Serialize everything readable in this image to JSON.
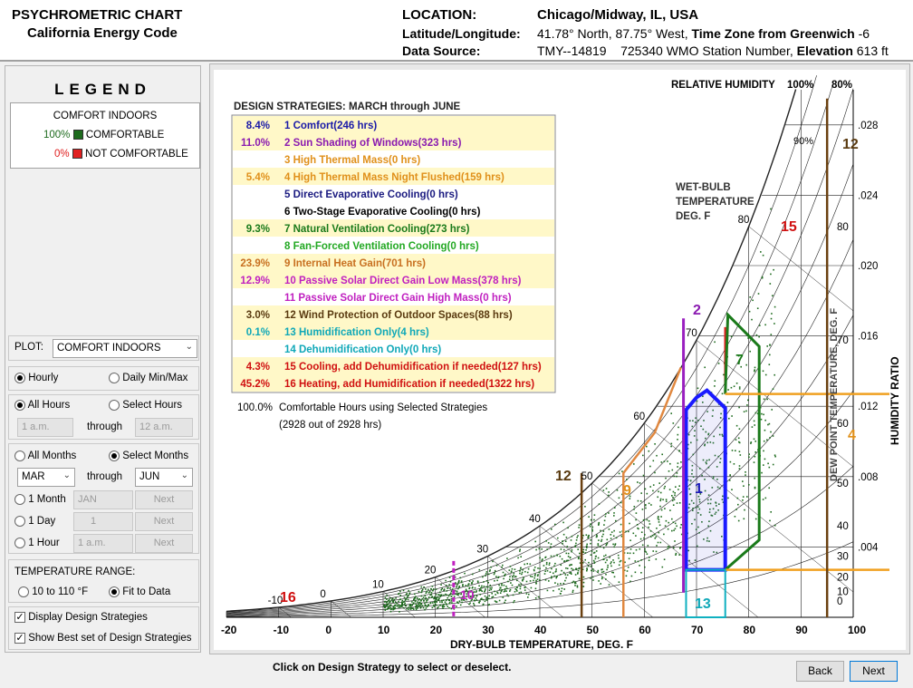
{
  "header": {
    "title1": "PSYCHROMETRIC CHART",
    "title2": "California Energy Code",
    "location_label": "LOCATION:",
    "location_value": "Chicago/Midway, IL, USA",
    "latlon_label": "Latitude/Longitude:",
    "latlon_value": "41.78° North, 87.75° West,",
    "tz_label": "Time Zone from Greenwich",
    "tz_value": "-6",
    "source_label": "Data Source:",
    "source_value": "TMY--14819",
    "wmo_value": "725340 WMO Station Number,",
    "elev_label": "Elevation",
    "elev_value": "613 ft"
  },
  "legend": {
    "title": "LEGEND",
    "subtitle": "COMFORT INDOORS",
    "items": [
      {
        "pct": "100%",
        "label": "COMFORTABLE",
        "color": "#1e6b1e"
      },
      {
        "pct": "0%",
        "label": "NOT COMFORTABLE",
        "color": "#e02020"
      }
    ]
  },
  "controls": {
    "plot_label": "PLOT:",
    "plot_value": "COMFORT INDOORS",
    "hourly": "Hourly",
    "daily": "Daily Min/Max",
    "all_hours": "All Hours",
    "select_hours": "Select Hours",
    "hour_from": "1 a.m.",
    "through": "through",
    "hour_to": "12 a.m.",
    "all_months": "All Months",
    "select_months": "Select Months",
    "month_from": "MAR",
    "month_to": "JUN",
    "one_month": "1 Month",
    "one_month_val": "JAN",
    "one_day": "1 Day",
    "one_day_val": "1",
    "one_hour": "1 Hour",
    "one_hour_val": "1 a.m.",
    "next": "Next",
    "temp_range_label": "TEMPERATURE RANGE:",
    "range_a": "10 to 110 °F",
    "range_b": "Fit to Data",
    "display_strategies": "Display Design Strategies",
    "show_best": "Show Best set of Design Strategies"
  },
  "strategies": {
    "title": "DESIGN STRATEGIES:  MARCH through JUNE",
    "rows": [
      {
        "pct": "8.4%",
        "label": "1  Comfort(246 hrs)",
        "color": "#1a1aa8",
        "bg": "#fff8c8"
      },
      {
        "pct": "11.0%",
        "label": "2  Sun Shading of Windows(323 hrs)",
        "color": "#8a1ab0",
        "bg": "#fff8c8"
      },
      {
        "pct": "",
        "label": "3  High Thermal Mass(0 hrs)",
        "color": "#e0901a",
        "bg": "#ffffff"
      },
      {
        "pct": "5.4%",
        "label": "4  High Thermal Mass Night Flushed(159 hrs)",
        "color": "#e0901a",
        "bg": "#fff8c8"
      },
      {
        "pct": "",
        "label": "5  Direct Evaporative Cooling(0 hrs)",
        "color": "#1a1a80",
        "bg": "#ffffff"
      },
      {
        "pct": "",
        "label": "6  Two-Stage Evaporative Cooling(0 hrs)",
        "color": "#000000",
        "bg": "#ffffff"
      },
      {
        "pct": "9.3%",
        "label": "7  Natural Ventilation Cooling(273 hrs)",
        "color": "#1a7a1a",
        "bg": "#fff8c8"
      },
      {
        "pct": "",
        "label": "8  Fan-Forced Ventilation Cooling(0 hrs)",
        "color": "#22a822",
        "bg": "#ffffff"
      },
      {
        "pct": "23.9%",
        "label": "9  Internal Heat Gain(701 hrs)",
        "color": "#c87020",
        "bg": "#fff8c8"
      },
      {
        "pct": "12.9%",
        "label": "10  Passive Solar Direct Gain Low Mass(378 hrs)",
        "color": "#c020c0",
        "bg": "#fff8c8"
      },
      {
        "pct": "",
        "label": "11  Passive Solar Direct Gain High Mass(0 hrs)",
        "color": "#c020c0",
        "bg": "#ffffff"
      },
      {
        "pct": "3.0%",
        "label": "12  Wind Protection of Outdoor Spaces(88 hrs)",
        "color": "#5a3a10",
        "bg": "#fff8c8"
      },
      {
        "pct": "0.1%",
        "label": "13  Humidification Only(4 hrs)",
        "color": "#10a8b8",
        "bg": "#fff8c8"
      },
      {
        "pct": "",
        "label": "14  Dehumidification Only(0 hrs)",
        "color": "#10a8b8",
        "bg": "#ffffff"
      },
      {
        "pct": "4.3%",
        "label": "15  Cooling, add Dehumidification if needed(127 hrs)",
        "color": "#d01010",
        "bg": "#fff8c8"
      },
      {
        "pct": "45.2%",
        "label": "16  Heating, add Humidification if needed(1322 hrs)",
        "color": "#d01010",
        "bg": "#fff8c8"
      }
    ],
    "total_pct": "100.0%",
    "total_label": "Comfortable Hours using Selected Strategies",
    "total_detail": "(2928 out of 2928 hrs)"
  },
  "chart": {
    "xlabel": "DRY-BULB TEMPERATURE, DEG. F",
    "ylabel": "HUMIDITY RATIO",
    "dewpoint_label": "DEW POINT TEMPERATURE, DEG. F",
    "rh_label": "RELATIVE HUMIDITY",
    "rh_100": "100%",
    "rh_80": "80%",
    "rh_90": "90%",
    "wb_label1": "WET-BULB",
    "wb_label2": "TEMPERATURE",
    "wb_label3": "DEG. F",
    "x_ticks": [
      "-20",
      "-10",
      "0",
      "10",
      "20",
      "30",
      "40",
      "50",
      "60",
      "70",
      "80",
      "90",
      "100"
    ],
    "y_ticks": [
      ".028",
      ".024",
      ".020",
      ".016",
      ".012",
      ".008",
      ".004"
    ],
    "dp_ticks": [
      "80",
      "70",
      "60",
      "50",
      "40",
      "30",
      "20",
      "10",
      "0"
    ],
    "wb_ticks": [
      "-10",
      "0",
      "10",
      "20",
      "30",
      "40",
      "50",
      "60",
      "70",
      "80"
    ],
    "zone_labels": {
      "z1": "1",
      "z2": "2",
      "z4": "4",
      "z7": "7",
      "z9": "9",
      "z10": "10",
      "z12a": "12",
      "z12b": "12",
      "z13": "13",
      "z15": "15",
      "z16": "16"
    }
  },
  "chart_data": {
    "type": "scatter",
    "xlabel": "DRY-BULB TEMPERATURE, DEG. F",
    "ylabel": "HUMIDITY RATIO",
    "xlim": [
      -20,
      100
    ],
    "ylim": [
      0,
      0.03
    ],
    "series": [
      {
        "name": "COMFORTABLE",
        "points": "hourly data points MAR–JUN (2928 hrs), dense band from 10°F to 85°F"
      }
    ]
  },
  "footer": {
    "hint": "Click on Design Strategy to select or deselect.",
    "back": "Back",
    "next": "Next"
  }
}
